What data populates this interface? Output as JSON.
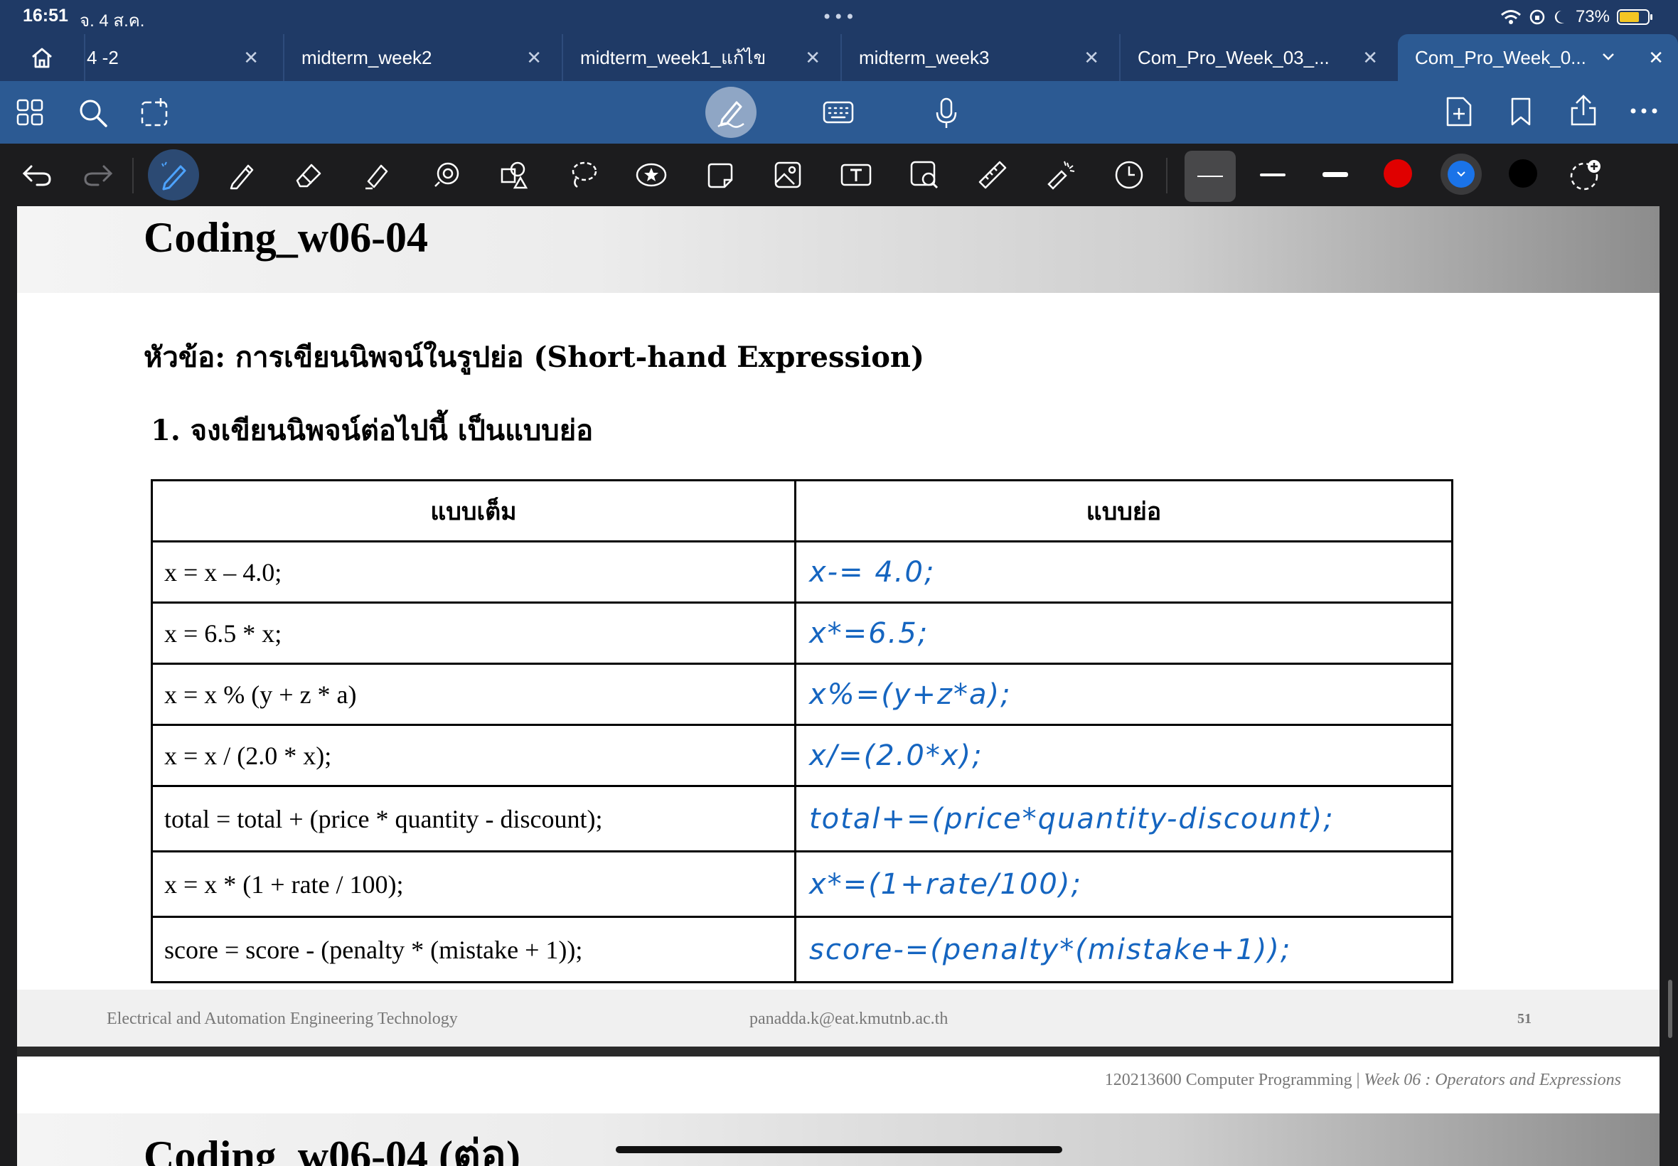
{
  "status": {
    "time": "16:51",
    "date": "จ. 4 ส.ค.",
    "battery": "73%",
    "multitask": "•••"
  },
  "tabs": [
    {
      "label": "4 -2",
      "close": "✕"
    },
    {
      "label": "midterm_week2",
      "close": "✕"
    },
    {
      "label": "midterm_week1_แก้ไข",
      "close": "✕"
    },
    {
      "label": "midterm_week3",
      "close": "✕"
    },
    {
      "label": "Com_Pro_Week_03_...",
      "close": "✕"
    },
    {
      "label": "Com_Pro_Week_0...",
      "close": "✕",
      "active": true
    }
  ],
  "colors": {
    "accent": "#2c5a93",
    "ink": "#1565c0",
    "red": "#e00000",
    "blue": "#1a73e8",
    "black": "#000000"
  },
  "slide": {
    "title": "Coding_w06-04",
    "topic": "หัวข้อ: การเขียนนิพจน์ในรูปย่อ (Short-hand Expression)",
    "question": "1. จงเขียนนิพจน์ต่อไปนี้ เป็นแบบย่อ",
    "headers": [
      "แบบเต็ม",
      "แบบย่อ"
    ],
    "rows": [
      {
        "full": "x = x – 4.0;",
        "short": "x-= 4.0;"
      },
      {
        "full": "x = 6.5 * x;",
        "short": "x*=6.5;"
      },
      {
        "full": "x = x % (y + z * a)",
        "short": "x%=(y+z*a);"
      },
      {
        "full": "x = x / (2.0 * x);",
        "short": "x/=(2.0*x);"
      },
      {
        "full": "total = total + (price * quantity - discount);",
        "short": "total+=(price*quantity-discount);"
      },
      {
        "full": "x = x * (1 + rate / 100);",
        "short": "x*=(1+rate/100);"
      },
      {
        "full": "score = score - (penalty * (mistake + 1));",
        "short": "score-=(penalty*(mistake+1));"
      }
    ],
    "footer_left": "Electrical and Automation Engineering Technology",
    "footer_mid": "panadda.k@eat.kmutnb.ac.th",
    "page_number": "51"
  },
  "next_slide": {
    "header_course": "120213600 Computer Programming | ",
    "header_week": "Week 06 : Operators and Expressions",
    "title": "Coding_w06-04 (ต่อ)"
  }
}
